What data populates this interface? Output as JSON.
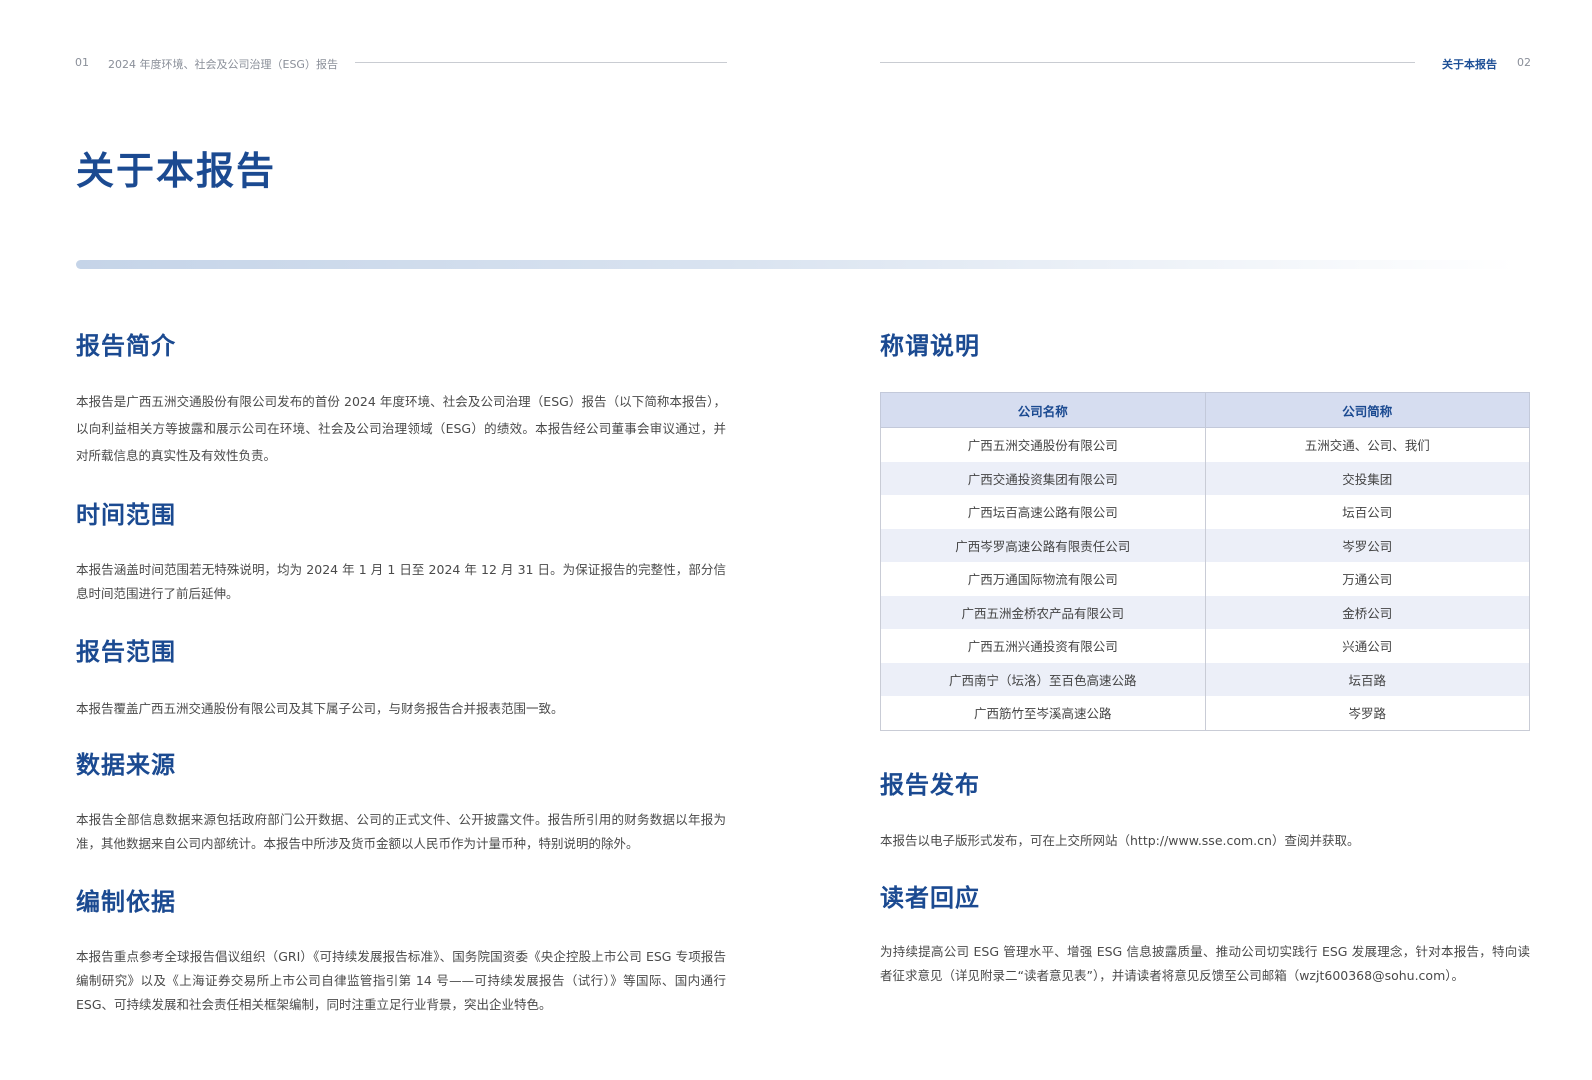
{
  "header": {
    "left_page_num": "01",
    "left_title": "2024 年度环境、社会及公司治理（ESG）报告",
    "right_title": "关于本报告",
    "right_page_num": "02"
  },
  "page_title": "关于本报告",
  "left_sections": [
    {
      "title": "报告简介",
      "text": "本报告是广西五洲交通股份有限公司发布的首份 2024 年度环境、社会及公司治理（ESG）报告（以下简称本报告），以向利益相关方等披露和展示公司在环境、社会及公司治理领域（ESG）的绩效。本报告经公司董事会审议通过，并对所载信息的真实性及有效性负责。"
    },
    {
      "title": "时间范围",
      "text": "本报告涵盖时间范围若无特殊说明，均为 2024 年 1 月 1 日至 2024 年 12 月 31 日。为保证报告的完整性，部分信息时间范围进行了前后延伸。"
    },
    {
      "title": "报告范围",
      "text": "本报告覆盖广西五洲交通股份有限公司及其下属子公司，与财务报告合并报表范围一致。"
    },
    {
      "title": "数据来源",
      "text": "本报告全部信息数据来源包括政府部门公开数据、公司的正式文件、公开披露文件。报告所引用的财务数据以年报为准，其他数据来自公司内部统计。本报告中所涉及货币金额以人民币作为计量币种，特别说明的除外。"
    },
    {
      "title": "编制依据",
      "text": "本报告重点参考全球报告倡议组织（GRI）《可持续发展报告标准》、国务院国资委《央企控股上市公司 ESG 专项报告编制研究》以及《上海证券交易所上市公司自律监管指引第 14 号——可持续发展报告（试行）》等国际、国内通行 ESG、可持续发展和社会责任相关框架编制，同时注重立足行业背景，突出企业特色。"
    }
  ],
  "names": {
    "title": "称谓说明",
    "headers": [
      "公司名称",
      "公司简称"
    ],
    "rows": [
      [
        "广西五洲交通股份有限公司",
        "五洲交通、公司、我们"
      ],
      [
        "广西交通投资集团有限公司",
        "交投集团"
      ],
      [
        "广西坛百高速公路有限公司",
        "坛百公司"
      ],
      [
        "广西岑罗高速公路有限责任公司",
        "岑罗公司"
      ],
      [
        "广西万通国际物流有限公司",
        "万通公司"
      ],
      [
        "广西五洲金桥农产品有限公司",
        "金桥公司"
      ],
      [
        "广西五洲兴通投资有限公司",
        "兴通公司"
      ],
      [
        "广西南宁（坛洛）至百色高速公路",
        "坛百路"
      ],
      [
        "广西筋竹至岑溪高速公路",
        "岑罗路"
      ]
    ]
  },
  "release": {
    "title": "报告发布",
    "text": "本报告以电子版形式发布，可在上交所网站（http://www.sse.com.cn）查阅并获取。"
  },
  "feedback": {
    "title": "读者回应",
    "text": "为持续提高公司 ESG 管理水平、增强 ESG 信息披露质量、推动公司切实践行 ESG 发展理念，针对本报告，特向读者征求意见（详见附录二“读者意见表”），并请读者将意见反馈至公司邮箱（wzjt600368@sohu.com）。"
  },
  "colors": {
    "brand_blue": "#1b4a91",
    "table_header_bg": "#d6ddf0",
    "table_alt_row_bg": "#eceff8"
  }
}
